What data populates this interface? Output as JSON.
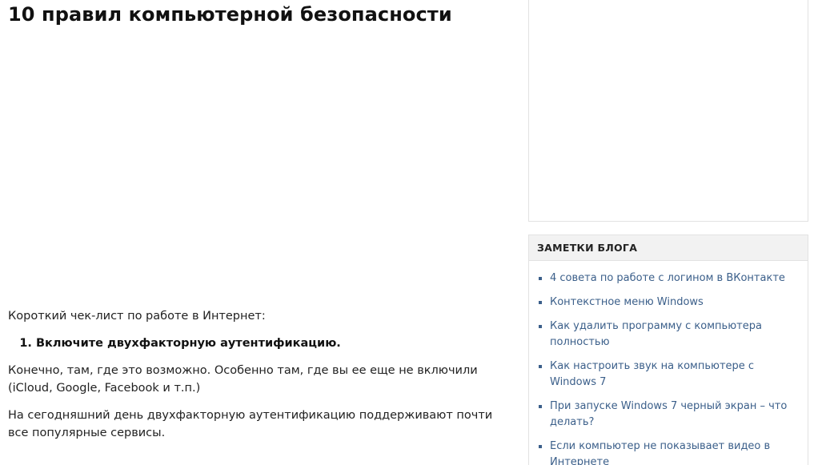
{
  "article": {
    "title": "10 правил компьютерной безопасности",
    "intro": "Короткий чек-лист по работе в Интернет:",
    "rules": [
      {
        "label": "Включите двухфакторную аутентификацию."
      }
    ],
    "paragraphs": [
      "Конечно, там, где это возможно. Особенно там, где вы ее еще не включили (iCloud, Google, Facebook и т.п.)",
      "На сегодняшний день двухфакторную аутентификацию поддерживают почти все популярные сервисы."
    ]
  },
  "sidebar": {
    "widget_title": "ЗАМЕТКИ БЛОГА",
    "links": [
      {
        "label": "4 совета по работе с логином в ВКонтакте"
      },
      {
        "label": "Контекстное меню Windows"
      },
      {
        "label": "Как удалить программу с компьютера полностью"
      },
      {
        "label": "Как настроить звук на компьютере с Windows 7"
      },
      {
        "label": "При запуске Windows 7 черный экран – что делать?"
      },
      {
        "label": "Если компьютер не показывает видео в Интернете"
      }
    ]
  },
  "colors": {
    "link": "#3b5f8a",
    "widget_header_bg": "#f2f2f2",
    "border": "#e2e2e2"
  }
}
